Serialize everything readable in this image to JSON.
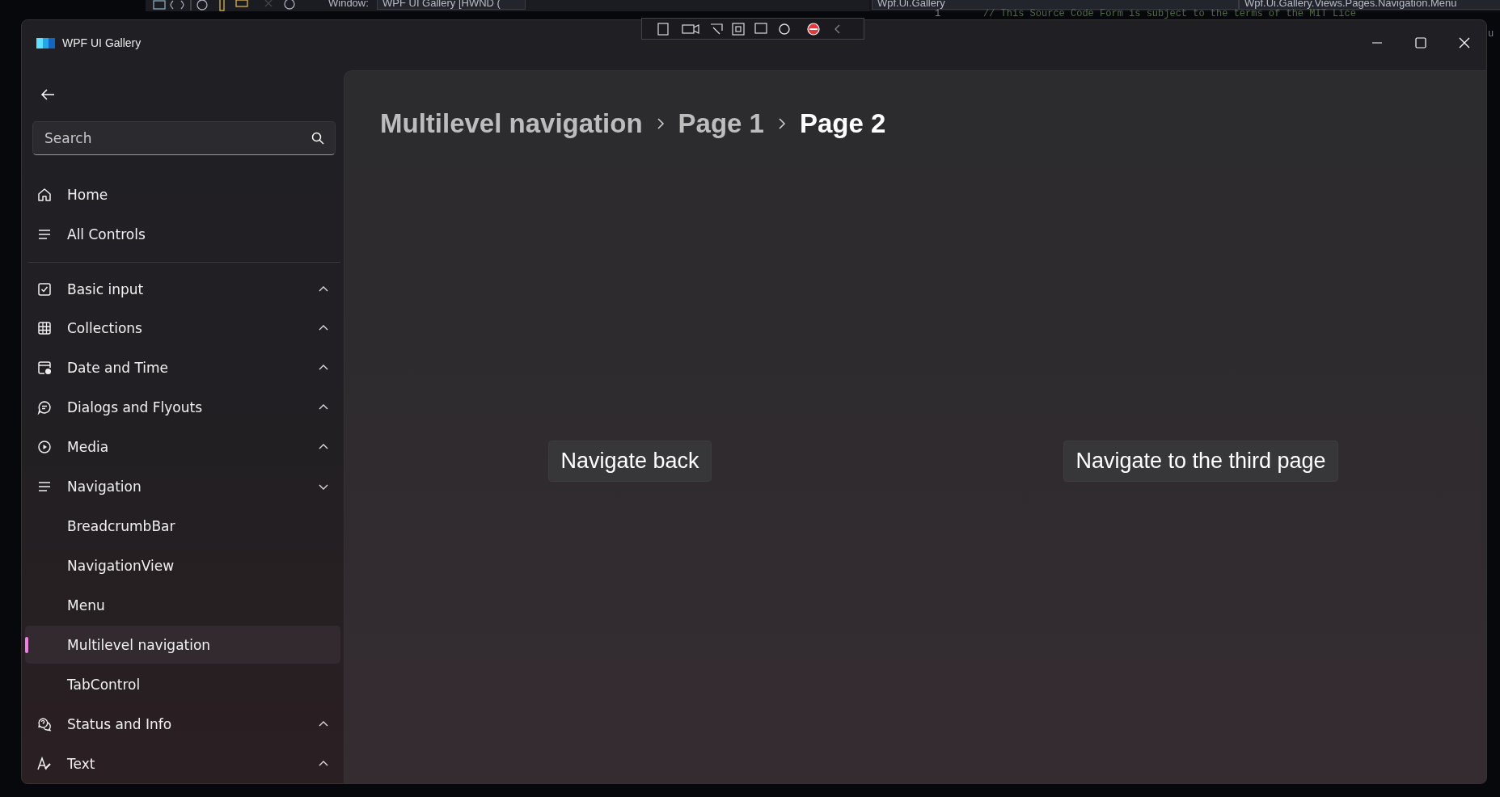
{
  "ide": {
    "window_label": "Window:",
    "window_combo": "WPF UI Gallery [HWND (",
    "project_combo": "Wpf.Ui.Gallery",
    "file_combo": "Wpf.Ui.Gallery.Views.Pages.Navigation.Menu",
    "line_number": "1",
    "code_line": "// This Source Code Form is subject to the terms of the MIT Lice",
    "code_fragment": "u"
  },
  "window": {
    "title": "WPF UI Gallery"
  },
  "search": {
    "placeholder": "Search"
  },
  "nav_top": [
    {
      "label": "Home",
      "selected": false
    },
    {
      "label": "All Controls",
      "selected": false
    }
  ],
  "nav_groups": [
    {
      "label": "Basic input",
      "expanded": false
    },
    {
      "label": "Collections",
      "expanded": false
    },
    {
      "label": "Date and Time",
      "expanded": false
    },
    {
      "label": "Dialogs and Flyouts",
      "expanded": false
    },
    {
      "label": "Media",
      "expanded": false
    },
    {
      "label": "Navigation",
      "expanded": true,
      "children": [
        {
          "label": "BreadcrumbBar",
          "selected": false
        },
        {
          "label": "NavigationView",
          "selected": false
        },
        {
          "label": "Menu",
          "selected": false
        },
        {
          "label": "Multilevel navigation",
          "selected": true
        },
        {
          "label": "TabControl",
          "selected": false
        }
      ]
    },
    {
      "label": "Status and Info",
      "expanded": false
    },
    {
      "label": "Text",
      "expanded": false
    }
  ],
  "breadcrumb": [
    {
      "label": "Multilevel navigation",
      "selected": false
    },
    {
      "label": "Page 1",
      "selected": false
    },
    {
      "label": "Page 2",
      "selected": true
    }
  ],
  "buttons": [
    {
      "label": "Navigate back"
    },
    {
      "label": "Navigate to the third page"
    }
  ]
}
